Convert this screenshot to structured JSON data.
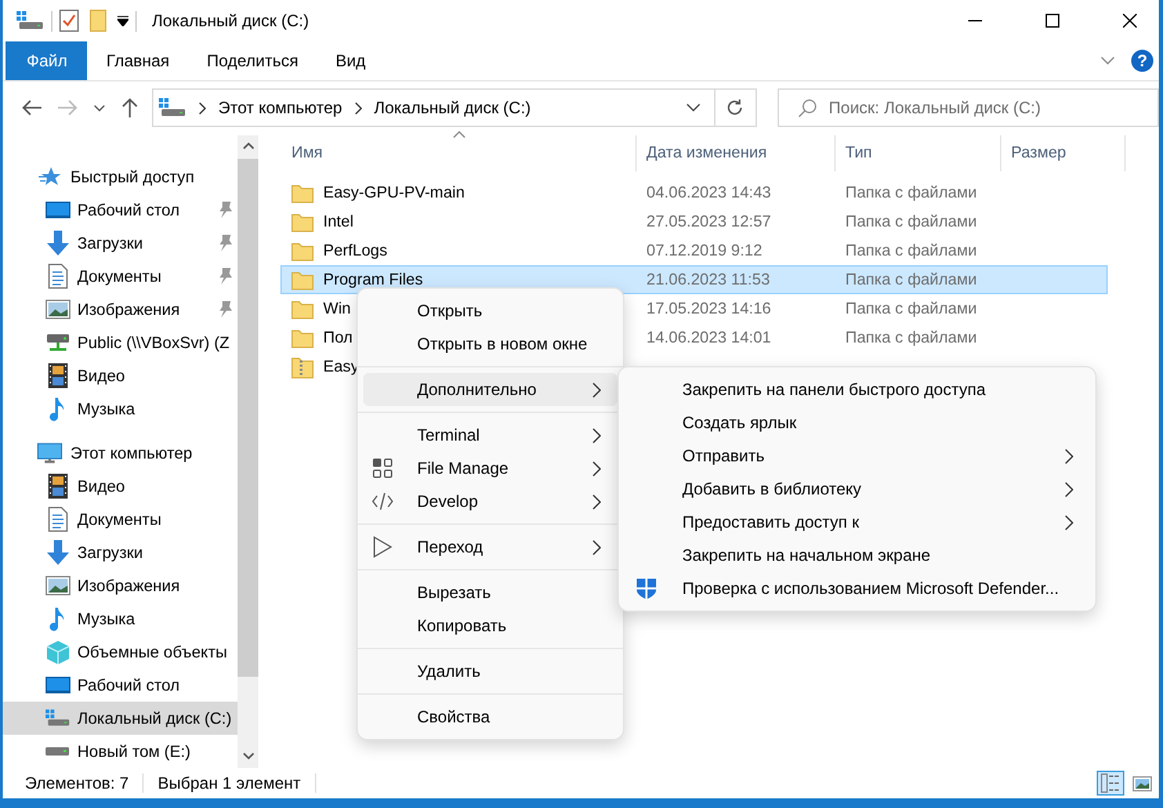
{
  "window": {
    "title": "Локальный диск (C:)"
  },
  "ribbon_tabs": [
    {
      "label": "Файл",
      "kind": "file"
    },
    {
      "label": "Главная",
      "kind": "tab"
    },
    {
      "label": "Поделиться",
      "kind": "tab"
    },
    {
      "label": "Вид",
      "kind": "tab"
    }
  ],
  "help": {
    "label": "?"
  },
  "address": {
    "path": [
      "Этот компьютер",
      "Локальный диск (C:)"
    ]
  },
  "search": {
    "placeholder": "Поиск: Локальный диск (C:)"
  },
  "sidebar": {
    "items": [
      {
        "label": "Быстрый доступ",
        "kind": "star",
        "selected": false,
        "children": [
          {
            "label": "Рабочий стол",
            "kind": "desktop",
            "pinned": true,
            "selected": false
          },
          {
            "label": "Загрузки",
            "kind": "download",
            "pinned": true,
            "selected": false
          },
          {
            "label": "Документы",
            "kind": "document",
            "pinned": true,
            "selected": false
          },
          {
            "label": "Изображения",
            "kind": "image",
            "pinned": true,
            "selected": false
          },
          {
            "label": "Public (\\\\VBoxSvr) (Z",
            "kind": "netdrive",
            "pinned": false,
            "selected": false
          },
          {
            "label": "Видео",
            "kind": "video",
            "pinned": false,
            "selected": false
          },
          {
            "label": "Музыка",
            "kind": "music",
            "pinned": false,
            "selected": false
          }
        ]
      },
      {
        "label": "Этот компьютер",
        "kind": "pc",
        "selected": false,
        "children": [
          {
            "label": "Видео",
            "kind": "video",
            "selected": false
          },
          {
            "label": "Документы",
            "kind": "document",
            "selected": false
          },
          {
            "label": "Загрузки",
            "kind": "download",
            "selected": false
          },
          {
            "label": "Изображения",
            "kind": "image",
            "selected": false
          },
          {
            "label": "Музыка",
            "kind": "music",
            "selected": false
          },
          {
            "label": "Объемные объекты",
            "kind": "cube",
            "selected": false
          },
          {
            "label": "Рабочий стол",
            "kind": "desktop",
            "selected": false
          },
          {
            "label": "Локальный диск (C:)",
            "kind": "sysdrive",
            "selected": true
          },
          {
            "label": "Новый том (E:)",
            "kind": "drive",
            "selected": false
          }
        ]
      }
    ]
  },
  "columns": [
    "Имя",
    "Дата изменения",
    "Тип",
    "Размер"
  ],
  "rows": [
    {
      "name": "Easy-GPU-PV-main",
      "date": "04.06.2023 14:43",
      "type": "Папка с файлами",
      "kind": "folder",
      "selected": false
    },
    {
      "name": "Intel",
      "date": "27.05.2023 12:57",
      "type": "Папка с файлами",
      "kind": "folder",
      "selected": false
    },
    {
      "name": "PerfLogs",
      "date": "07.12.2019 9:12",
      "type": "Папка с файлами",
      "kind": "folder",
      "selected": false
    },
    {
      "name": "Program Files",
      "date": "21.06.2023 11:53",
      "type": "Папка с файлами",
      "kind": "folder",
      "selected": true
    },
    {
      "name": "Win",
      "date": "17.05.2023 14:16",
      "type": "Папка с файлами",
      "kind": "folder",
      "selected": false
    },
    {
      "name": "Пол",
      "date": "14.06.2023 14:01",
      "type": "Папка с файлами",
      "kind": "folder",
      "selected": false
    },
    {
      "name": "Easy",
      "kind": "zip",
      "selected": false
    }
  ],
  "context_menu": {
    "groups": [
      [
        {
          "label": "Открыть",
          "kind": "plain",
          "submenu": false,
          "selected": false
        },
        {
          "label": "Открыть в новом окне",
          "kind": "plain",
          "submenu": false,
          "selected": false
        }
      ],
      [
        {
          "label": "Дополнительно",
          "kind": "plain",
          "submenu": true,
          "selected": true
        }
      ],
      [
        {
          "label": "Terminal",
          "kind": "plain",
          "submenu": true,
          "selected": false
        },
        {
          "label": "File Manage",
          "kind": "grid",
          "submenu": true,
          "selected": false
        },
        {
          "label": "Develop",
          "kind": "code",
          "submenu": true,
          "selected": false
        }
      ],
      [
        {
          "label": "Переход",
          "kind": "cursor",
          "submenu": true,
          "selected": false
        }
      ],
      [
        {
          "label": "Вырезать",
          "kind": "plain",
          "submenu": false,
          "selected": false
        },
        {
          "label": "Копировать",
          "kind": "plain",
          "submenu": false,
          "selected": false
        }
      ],
      [
        {
          "label": "Удалить",
          "kind": "plain",
          "submenu": false,
          "selected": false
        }
      ],
      [
        {
          "label": "Свойства",
          "kind": "plain",
          "submenu": false,
          "selected": false
        }
      ]
    ]
  },
  "submenu": {
    "items": [
      {
        "label": "Закрепить на панели быстрого доступа",
        "kind": "plain",
        "submenu": false
      },
      {
        "label": "Создать ярлык",
        "kind": "plain",
        "submenu": false
      },
      {
        "label": "Отправить",
        "kind": "plain",
        "submenu": true
      },
      {
        "label": "Добавить в библиотеку",
        "kind": "plain",
        "submenu": true
      },
      {
        "label": "Предоставить доступ к",
        "kind": "plain",
        "submenu": true
      },
      {
        "label": "Закрепить на начальном экране",
        "kind": "plain",
        "submenu": false
      },
      {
        "label": "Проверка с использованием Microsoft Defender...",
        "kind": "shield",
        "submenu": false
      }
    ]
  },
  "status_bar": {
    "count": "Элементов: 7",
    "selection": "Выбран 1 элемент"
  },
  "view_buttons": [
    {
      "kind": "details",
      "selected": true
    },
    {
      "kind": "thumbnails",
      "selected": false
    }
  ]
}
